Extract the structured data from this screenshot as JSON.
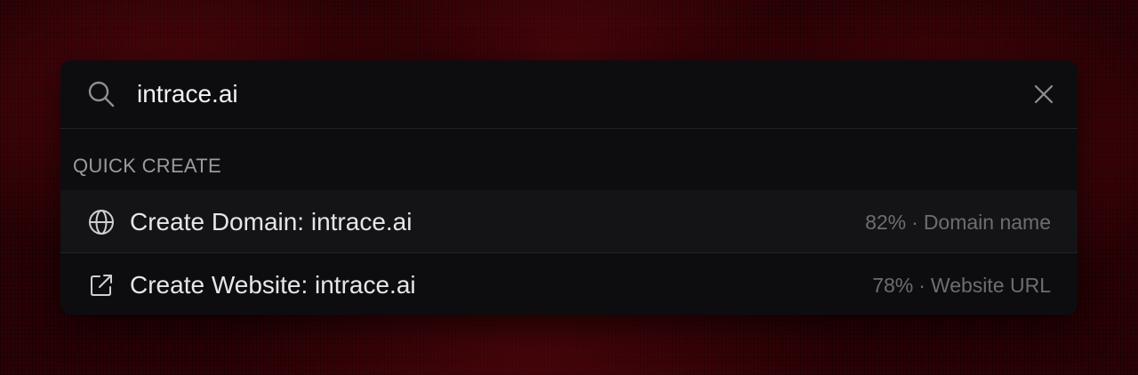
{
  "search": {
    "value": "intrace.ai",
    "icon": "search-icon",
    "clear_icon": "close-icon"
  },
  "section": {
    "title": "QUICK CREATE"
  },
  "items": [
    {
      "label": "Create Domain: intrace.ai",
      "score": "82%",
      "separator": "·",
      "type": "Domain name",
      "icon": "globe-icon"
    },
    {
      "label": "Create Website: intrace.ai",
      "score": "78%",
      "separator": "·",
      "type": "Website URL",
      "icon": "external-link-icon"
    }
  ],
  "colors": {
    "background": "#2a0205",
    "panel": "#0d0d0f",
    "highlight_row": "#141416",
    "text_primary": "#e6e6e8",
    "text_muted": "#6d6d72"
  }
}
